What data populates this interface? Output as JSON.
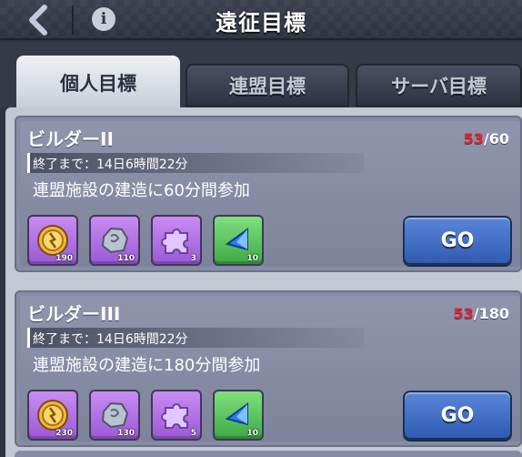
{
  "header": {
    "title": "遠征目標",
    "back_icon": "chevron-left-icon",
    "info_icon": "info-icon",
    "info_glyph": "i"
  },
  "tabs": [
    {
      "label": "個人目標",
      "active": true
    },
    {
      "label": "連盟目標",
      "active": false
    },
    {
      "label": "サーバ目標",
      "active": false
    }
  ],
  "quests": [
    {
      "title": "ビルダーII",
      "progress_current": "53",
      "progress_total": "60",
      "progress_sep": "/",
      "timer": "終了まで：14日6時間22分",
      "description": "連盟施設の建造に60分間参加",
      "rewards": [
        {
          "icon": "speedup-coin-icon",
          "count": "190",
          "color": "purple"
        },
        {
          "icon": "stone-ore-icon",
          "count": "110",
          "color": "purple"
        },
        {
          "icon": "puzzle-piece-icon",
          "count": "3",
          "color": "purple"
        },
        {
          "icon": "blue-crystal-icon",
          "count": "10",
          "color": "green"
        }
      ],
      "go_label": "GO"
    },
    {
      "title": "ビルダーIII",
      "progress_current": "53",
      "progress_total": "180",
      "progress_sep": "/",
      "timer": "終了まで：14日6時間22分",
      "description": "連盟施設の建造に180分間参加",
      "rewards": [
        {
          "icon": "speedup-coin-icon",
          "count": "230",
          "color": "purple"
        },
        {
          "icon": "stone-ore-icon",
          "count": "130",
          "color": "purple"
        },
        {
          "icon": "puzzle-piece-icon",
          "count": "5",
          "color": "purple"
        },
        {
          "icon": "blue-crystal-icon",
          "count": "10",
          "color": "green"
        }
      ],
      "go_label": "GO"
    }
  ],
  "colors": {
    "accent_red": "#e5222a",
    "go_blue": "#3f6cc4",
    "reward_purple": "#b06fe6",
    "reward_green": "#55c05a"
  }
}
